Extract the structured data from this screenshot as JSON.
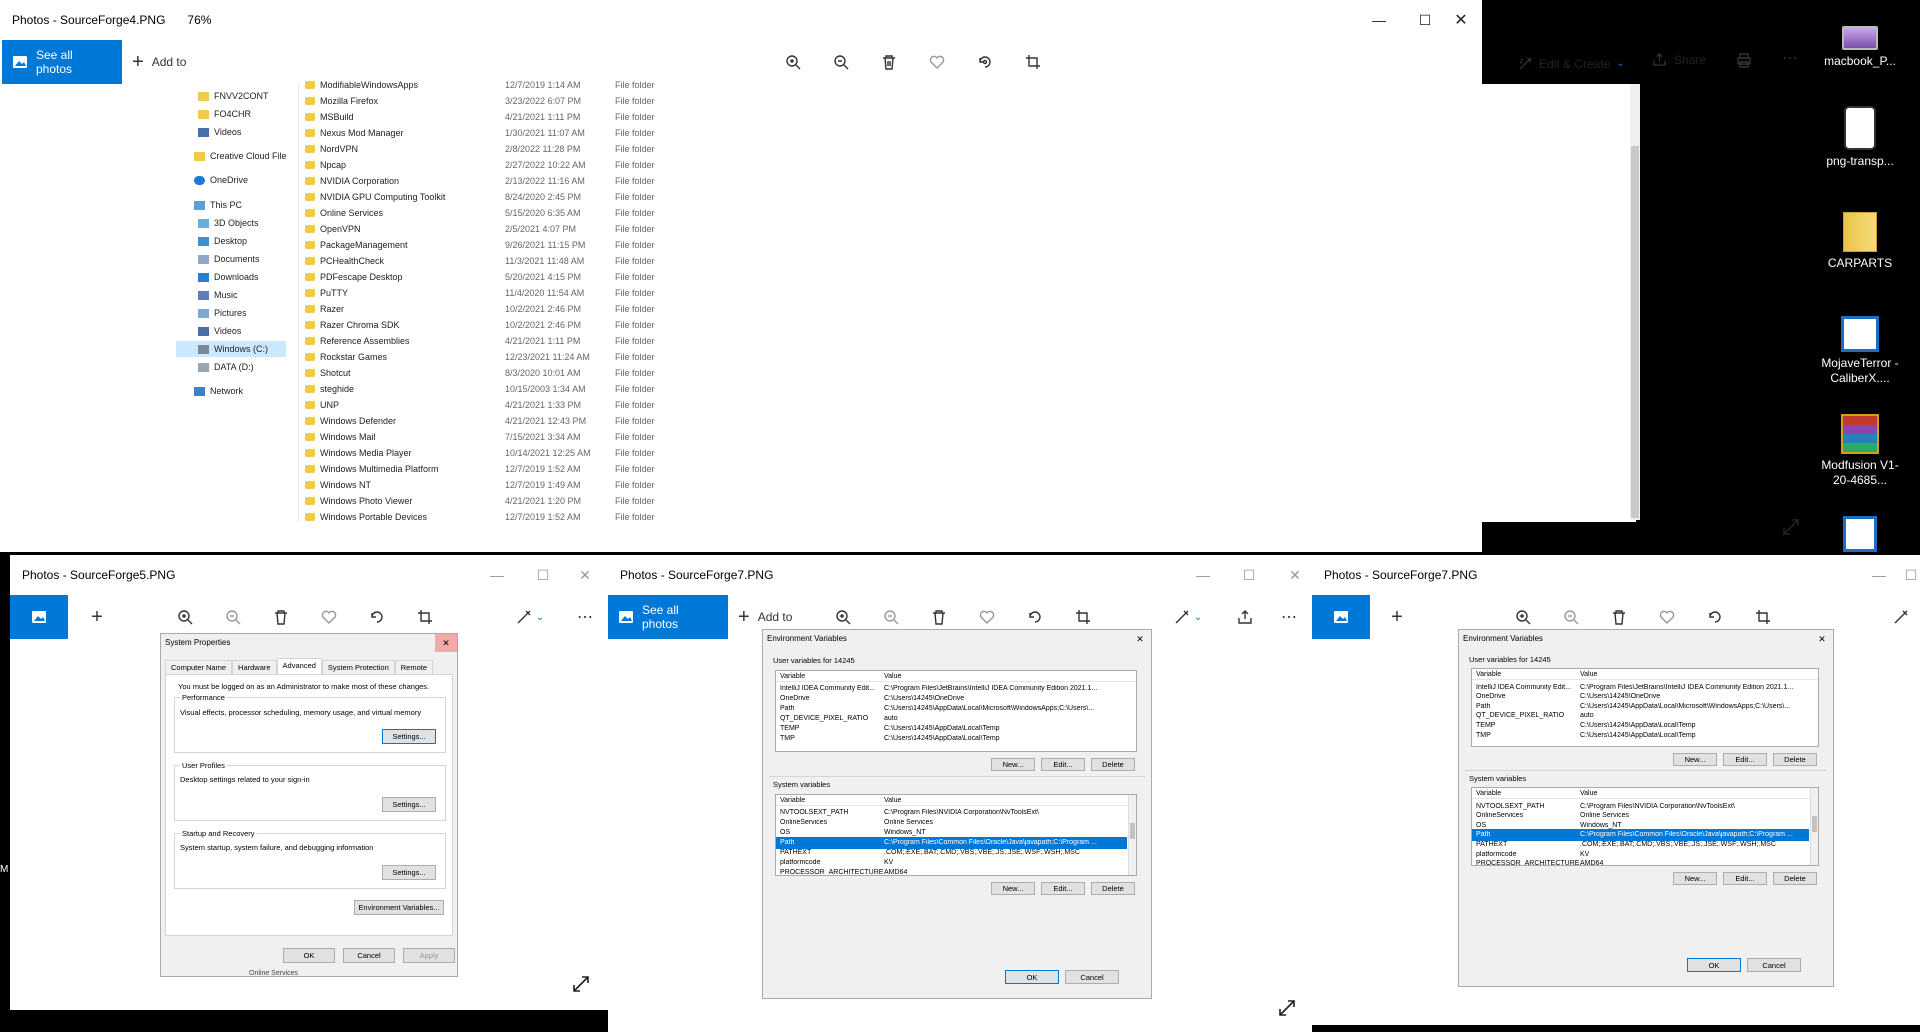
{
  "colors": {
    "accent": "#0078d7",
    "folder": "#f2c94c",
    "selection": "#0078d7"
  },
  "main_window": {
    "title": "Photos - SourceForge4.PNG",
    "zoom": "76%",
    "see_all_photos": "See all photos",
    "add_to": "Add to",
    "edit_create": "Edit & Create",
    "share": "Share",
    "explorer": {
      "nav": [
        {
          "label": "FNVV2CONT",
          "icon": "folder-icon"
        },
        {
          "label": "FO4CHR",
          "icon": "folder-icon"
        },
        {
          "label": "Videos",
          "icon": "videos-icon"
        },
        {
          "label": "Creative Cloud File",
          "icon": "creative-cloud-icon"
        },
        {
          "label": "OneDrive",
          "icon": "onedrive-icon"
        },
        {
          "label": "This PC",
          "icon": "pc-icon"
        },
        {
          "label": "3D Objects",
          "icon": "3d-objects-icon"
        },
        {
          "label": "Desktop",
          "icon": "desktop-icon"
        },
        {
          "label": "Documents",
          "icon": "documents-icon"
        },
        {
          "label": "Downloads",
          "icon": "downloads-icon"
        },
        {
          "label": "Music",
          "icon": "music-icon"
        },
        {
          "label": "Pictures",
          "icon": "pictures-icon"
        },
        {
          "label": "Videos",
          "icon": "videos-icon"
        },
        {
          "label": "Windows (C:)",
          "icon": "drive-icon"
        },
        {
          "label": "DATA (D:)",
          "icon": "drive-icon"
        },
        {
          "label": "Network",
          "icon": "network-icon"
        }
      ],
      "rows": [
        {
          "name": "ModifiableWindowsApps",
          "date": "12/7/2019 1:14 AM",
          "type": "File folder"
        },
        {
          "name": "Mozilla Firefox",
          "date": "3/23/2022 6:07 PM",
          "type": "File folder"
        },
        {
          "name": "MSBuild",
          "date": "4/21/2021 1:11 PM",
          "type": "File folder"
        },
        {
          "name": "Nexus Mod Manager",
          "date": "1/30/2021 11:07 AM",
          "type": "File folder"
        },
        {
          "name": "NordVPN",
          "date": "2/8/2022 11:28 PM",
          "type": "File folder"
        },
        {
          "name": "Npcap",
          "date": "2/27/2022 10:22 AM",
          "type": "File folder"
        },
        {
          "name": "NVIDIA Corporation",
          "date": "2/13/2022 11:16 AM",
          "type": "File folder"
        },
        {
          "name": "NVIDIA GPU Computing Toolkit",
          "date": "8/24/2020 2:45 PM",
          "type": "File folder"
        },
        {
          "name": "Online Services",
          "date": "5/15/2020 6:35 AM",
          "type": "File folder"
        },
        {
          "name": "OpenVPN",
          "date": "2/5/2021 4:07 PM",
          "type": "File folder"
        },
        {
          "name": "PackageManagement",
          "date": "9/26/2021 11:15 PM",
          "type": "File folder"
        },
        {
          "name": "PCHealthCheck",
          "date": "11/3/2021 11:48 AM",
          "type": "File folder"
        },
        {
          "name": "PDFescape Desktop",
          "date": "5/20/2021 4:15 PM",
          "type": "File folder"
        },
        {
          "name": "PuTTY",
          "date": "11/4/2020 11:54 AM",
          "type": "File folder"
        },
        {
          "name": "Razer",
          "date": "10/2/2021 2:46 PM",
          "type": "File folder"
        },
        {
          "name": "Razer Chroma SDK",
          "date": "10/2/2021 2:46 PM",
          "type": "File folder"
        },
        {
          "name": "Reference Assemblies",
          "date": "4/21/2021 1:11 PM",
          "type": "File folder"
        },
        {
          "name": "Rockstar Games",
          "date": "12/23/2021 11:24 AM",
          "type": "File folder"
        },
        {
          "name": "Shotcut",
          "date": "8/3/2020 10:01 AM",
          "type": "File folder"
        },
        {
          "name": "steghide",
          "date": "10/15/2003 1:34 AM",
          "type": "File folder"
        },
        {
          "name": "UNP",
          "date": "4/21/2021 1:33 PM",
          "type": "File folder"
        },
        {
          "name": "Windows Defender",
          "date": "4/21/2021 12:43 PM",
          "type": "File folder"
        },
        {
          "name": "Windows Mail",
          "date": "7/15/2021 3:34 AM",
          "type": "File folder"
        },
        {
          "name": "Windows Media Player",
          "date": "10/14/2021 12:25 AM",
          "type": "File folder"
        },
        {
          "name": "Windows Multimedia Platform",
          "date": "12/7/2019 1:52 AM",
          "type": "File folder"
        },
        {
          "name": "Windows NT",
          "date": "12/7/2019 1:49 AM",
          "type": "File folder"
        },
        {
          "name": "Windows Photo Viewer",
          "date": "4/21/2021 1:20 PM",
          "type": "File folder"
        },
        {
          "name": "Windows Portable Devices",
          "date": "12/7/2019 1:52 AM",
          "type": "File folder"
        }
      ]
    }
  },
  "win2": {
    "title": "Photos - SourceForge5.PNG",
    "dialog": {
      "title": "System Properties",
      "tabs": [
        "Computer Name",
        "Hardware",
        "Advanced",
        "System Protection",
        "Remote"
      ],
      "admin_note": "You must be logged on as an Administrator to make most of these changes.",
      "perf_title": "Performance",
      "perf_desc": "Visual effects, processor scheduling, memory usage, and virtual memory",
      "profiles_title": "User Profiles",
      "profiles_desc": "Desktop settings related to your sign-in",
      "startup_title": "Startup and Recovery",
      "startup_desc": "System startup, system failure, and debugging information",
      "settings": "Settings...",
      "env_vars": "Environment Variables...",
      "ok": "OK",
      "cancel": "Cancel",
      "apply": "Apply",
      "behind_text": "Online Services"
    }
  },
  "env_dialog": {
    "title": "Environment Variables",
    "user_header": "User variables for 14245",
    "col_variable": "Variable",
    "col_value": "Value",
    "user_vars": [
      {
        "name": "IntelliJ IDEA Community Edit...",
        "value": "C:\\Program Files\\JetBrains\\IntelliJ IDEA Community Edition 2021.1..."
      },
      {
        "name": "OneDrive",
        "value": "C:\\Users\\14245\\OneDrive"
      },
      {
        "name": "Path",
        "value": "C:\\Users\\14245\\AppData\\Local\\Microsoft\\WindowsApps;C:\\Users\\..."
      },
      {
        "name": "QT_DEVICE_PIXEL_RATIO",
        "value": "auto"
      },
      {
        "name": "TEMP",
        "value": "C:\\Users\\14245\\AppData\\Local\\Temp"
      },
      {
        "name": "TMP",
        "value": "C:\\Users\\14245\\AppData\\Local\\Temp"
      }
    ],
    "system_header": "System variables",
    "system_vars": [
      {
        "name": "NVTOOLSEXT_PATH",
        "value": "C:\\Program Files\\NVIDIA Corporation\\NvToolsExt\\"
      },
      {
        "name": "OnlineServices",
        "value": "Online Services"
      },
      {
        "name": "OS",
        "value": "Windows_NT"
      },
      {
        "name": "Path",
        "value": "C:\\Program Files\\Common Files\\Oracle\\Java\\javapath;C:\\Program ..."
      },
      {
        "name": "PATHEXT",
        "value": ".COM;.EXE;.BAT;.CMD;.VBS;.VBE;.JS;.JSE;.WSF;.WSH;.MSC"
      },
      {
        "name": "platformcode",
        "value": "KV"
      },
      {
        "name": "PROCESSOR_ARCHITECTURE",
        "value": "AMD64"
      }
    ],
    "new": "New...",
    "edit": "Edit...",
    "delete": "Delete",
    "ok": "OK",
    "cancel": "Cancel"
  },
  "win3": {
    "title": "Photos - SourceForge7.PNG",
    "see_all_photos": "See all photos",
    "add_to": "Add to"
  },
  "win4": {
    "title": "Photos - SourceForge7.PNG"
  },
  "desktop": {
    "icons": [
      {
        "label": "macbook_P...",
        "icon": "laptop-image-icon"
      },
      {
        "label": "png-transp...",
        "icon": "phone-image-icon"
      },
      {
        "label": "CARPARTS",
        "icon": "folder-icon"
      },
      {
        "label": "MojaveTerror - CaliberX....",
        "icon": "document-icon"
      },
      {
        "label": "Modfusion V1-20-4685...",
        "icon": "winrar-icon"
      }
    ],
    "edge_char": "M"
  }
}
